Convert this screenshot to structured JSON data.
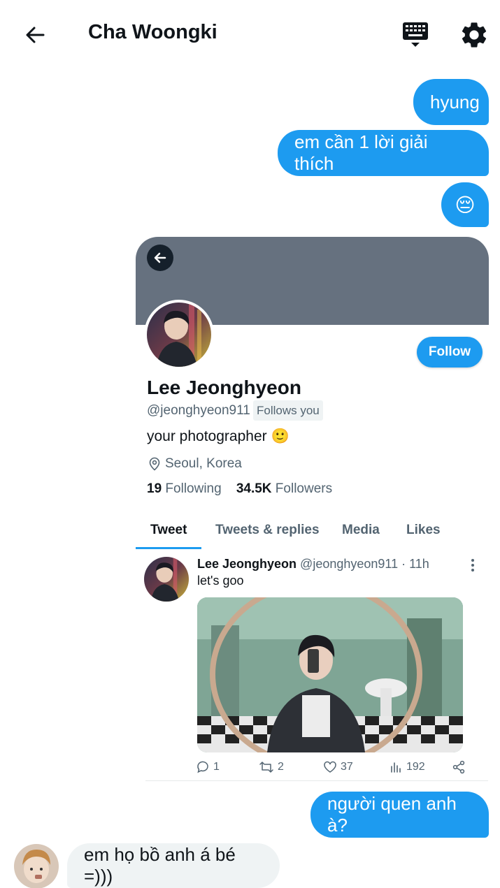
{
  "header": {
    "title": "Cha Woongki",
    "back_icon": "arrow-left-icon",
    "keyboard_icon": "keyboard-icon",
    "settings_icon": "gear-icon"
  },
  "messages_top": {
    "m1": "hyung",
    "m2": "em cần 1 lời giải thích",
    "m3": "😔"
  },
  "profile": {
    "name": "Lee Jeonghyeon",
    "handle": "@jeonghyeon911",
    "follows_you": "Follows you",
    "follow_button": "Follow",
    "bio": "your photographer",
    "bio_emoji": "🙂",
    "location": "Seoul, Korea",
    "following_count": "19",
    "following_label": "Following",
    "followers_count": "34.5K",
    "followers_label": "Followers",
    "banner_color": "#66717f",
    "tabs": [
      "Tweet",
      "Tweets & replies",
      "Media",
      "Likes"
    ]
  },
  "tweet": {
    "name": "Lee Jeonghyeon",
    "handle_time": "@jeonghyeon911 · 11h",
    "text": "let's goo",
    "replies": "1",
    "retweets": "2",
    "likes": "37",
    "views": "192"
  },
  "messages_bottom": {
    "sent": "người quen anh à?",
    "received": "em họ bồ anh á bé =)))"
  },
  "colors": {
    "accent": "#1d9bf0",
    "incoming_bubble": "#eff3f4",
    "muted_text": "#536471"
  }
}
